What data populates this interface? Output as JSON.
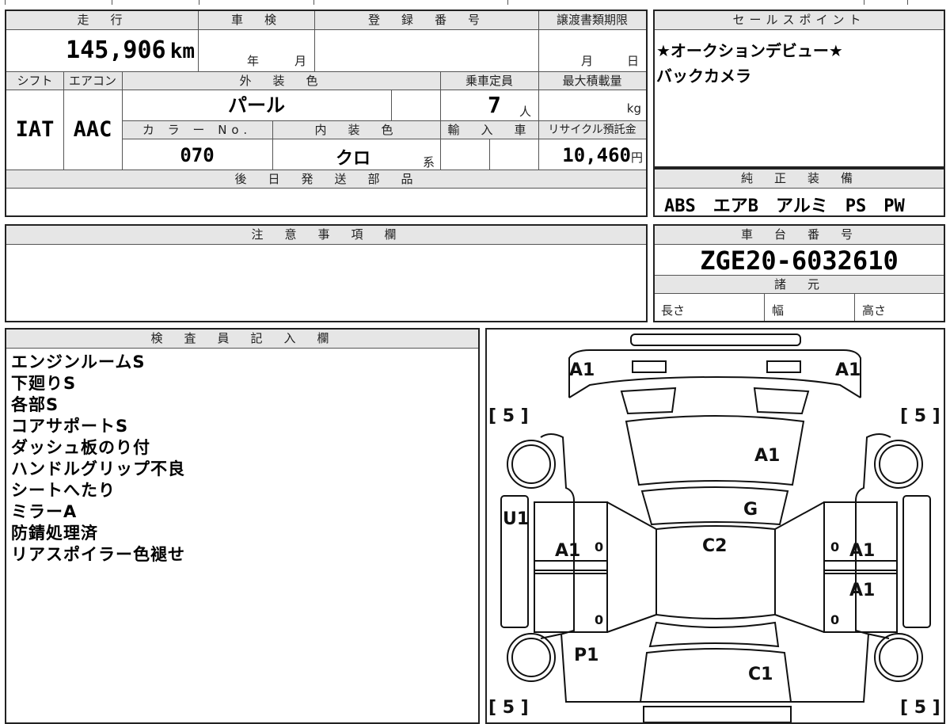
{
  "vehicle": {
    "mileage_label": "走　行",
    "mileage_value": "145,906",
    "mileage_unit": "km",
    "shaken_label": "車　検",
    "shaken_year": "年",
    "shaken_month": "月",
    "reg_label": "登　録　番　号",
    "transfer_label": "譲渡書類期限",
    "transfer_month": "月",
    "transfer_day": "日",
    "shift_label": "シフト",
    "shift_value": "IAT",
    "ac_label": "エアコン",
    "ac_value": "AAC",
    "exterior_label": "外　装　色",
    "exterior_value": "パール",
    "capacity_label": "乗車定員",
    "capacity_value": "7",
    "capacity_unit": "人",
    "load_label": "最大積載量",
    "load_unit": "kg",
    "color_no_label": "カ ラ ー No.",
    "color_no_value": "070",
    "interior_label": "内　装　色",
    "interior_value": "クロ",
    "interior_suffix": "系",
    "import_label": "輸　入　車",
    "recycle_label": "リサイクル預託金",
    "recycle_value": "10,460",
    "recycle_unit": "円",
    "later_parts_label": "後　日　発　送　部　品"
  },
  "sales": {
    "label": "セールスポイント",
    "lines": [
      "★オークションデビュー★",
      "バックカメラ"
    ]
  },
  "equipment": {
    "label": "純　正　装　備",
    "value": "ABS　エアB　アルミ　PS　PW"
  },
  "caution": {
    "label": "注　意　事　項　欄"
  },
  "chassis": {
    "label": "車　台　番　号",
    "value": "ZGE20-6032610",
    "spec_label": "諸　元",
    "length_label": "長さ",
    "width_label": "幅",
    "height_label": "高さ"
  },
  "inspector": {
    "label": "検　査　員　記　入　欄",
    "notes": [
      "エンジンルームS",
      "下廻りS",
      "各部S",
      "コアサポートS",
      "ダッシュ板のり付",
      "ハンドルグリップ不良",
      "シートへたり",
      "ミラーA",
      "防錆処理済",
      "リアスポイラー色褪せ"
    ]
  },
  "diagram": {
    "marks": [
      "A1",
      "A1",
      "A1",
      "G",
      "U1",
      "A1",
      "C2",
      "A1",
      "A1",
      "P1",
      "C1"
    ],
    "tires": [
      "[ 5 ]",
      "[ 5 ]",
      "[ 5 ]",
      "[ 5 ]"
    ],
    "small_zeros": [
      "0",
      "0",
      "0",
      "0"
    ]
  }
}
